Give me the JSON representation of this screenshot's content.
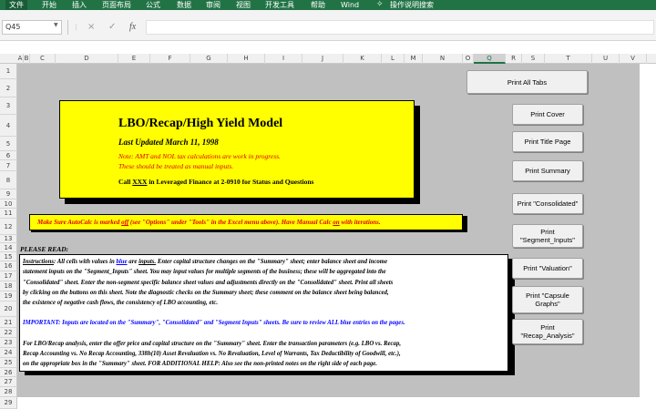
{
  "ribbon": {
    "tabs": [
      "文件",
      "开始",
      "插入",
      "页面布局",
      "公式",
      "数据",
      "审阅",
      "视图",
      "开发工具",
      "帮助",
      "Wind"
    ],
    "tell_me": "操作说明搜索"
  },
  "formula_bar": {
    "name_box": "Q45",
    "cancel": "×",
    "enter": "✓",
    "fx": "fx",
    "value": ""
  },
  "columns": [
    "A",
    "B",
    "C",
    "D",
    "E",
    "F",
    "G",
    "H",
    "I",
    "J",
    "K",
    "L",
    "M",
    "N",
    "O",
    "Q",
    "R",
    "S",
    "T",
    "U",
    "V"
  ],
  "selected_column": "Q",
  "rows": [
    "1",
    "2",
    "3",
    "4",
    "5",
    "6",
    "7",
    "8",
    "9",
    "10",
    "11",
    "12",
    "13",
    "14",
    "15",
    "16",
    "17",
    "18",
    "19",
    "20",
    "21",
    "22",
    "23",
    "24",
    "25",
    "26",
    "27",
    "28",
    "29"
  ],
  "title_box": {
    "title": "LBO/Recap/High Yield Model",
    "updated": "Last Updated March 11, 1998",
    "note1": "Note:  AMT and NOL tax calculations are work in progress.",
    "note2": "These should be treated as manual inputs.",
    "call_pre": "Call ",
    "call_xxx": "XXX",
    "call_post": " in Leveraged Finance at 2-0910 for Status and Questions"
  },
  "autocalc": {
    "p1": "Make Sure AutoCalc is marked  ",
    "off": "off",
    "p2": "  (see \"Options\" under \"Tools\" in the Excel menu above).  Have Manual Calc  ",
    "on": "on",
    "p3": "  with iterations."
  },
  "please_read": "PLEASE READ:",
  "instructions": {
    "label": "Instructions",
    "l1a": ":  All cells with values in  ",
    "l1_blue": "blue",
    "l1b": "  are  ",
    "l1_inputs": "inputs.",
    "l1c": "  Enter capital structure changes on the \"Summary\" sheet; enter balance sheet and income",
    "l2": "statement inputs on the \"Segment_Inputs\" sheet.  You may input values for multiple segments of the business; these will be aggregated into the",
    "l3": "\"Consolidated\" sheet.  Enter the non-segment specific balance sheet values and adjustments directly on the \"Consolidated\" sheet.  Print all sheets",
    "l4": "by clicking on the buttons on this sheet.  Note the diagnostic checks on the Summary sheet; these comment on the balance sheet being balanced,",
    "l5": "the existence of negative cash flows, the consistency of LBO accounting, etc.",
    "important": "IMPORTANT:  Inputs are located on the \"Summary\", \"Consolidated\" and \"Segment Inputs\" sheets.  Be sure to review ALL blue entries on the pages.",
    "l6": "For LBO/Recap analysis, enter the offer price and capital structure on the \"Summary\" sheet.  Enter the transaction parameters (e.g. LBO vs. Recap,",
    "l7": "Recap Accounting vs. No Recap Accounting, 338h(10) Asset Revaluation vs. No Revaluation, Level of Warrants, Tax Deductibility of Goodwill, etc.),",
    "l8": "on the appropriate box in the \"Summary\" sheet.  FOR ADDITIONAL HELP:  Also see the non-printed notes on the right side of each page."
  },
  "buttons": {
    "print_all": "Print All Tabs",
    "cover": "Print Cover",
    "title_page": "Print Title Page",
    "summary": "Print Summary",
    "consolidated": "Print \"Consolidated\"",
    "segment_inputs": "Print\n\"Segment_Inputs\"",
    "valuation": "Print \"Valuation\"",
    "capsule": "Print \"Capsule\nGraphs\"",
    "recap": "Print\n\"Recap_Analysis\""
  }
}
